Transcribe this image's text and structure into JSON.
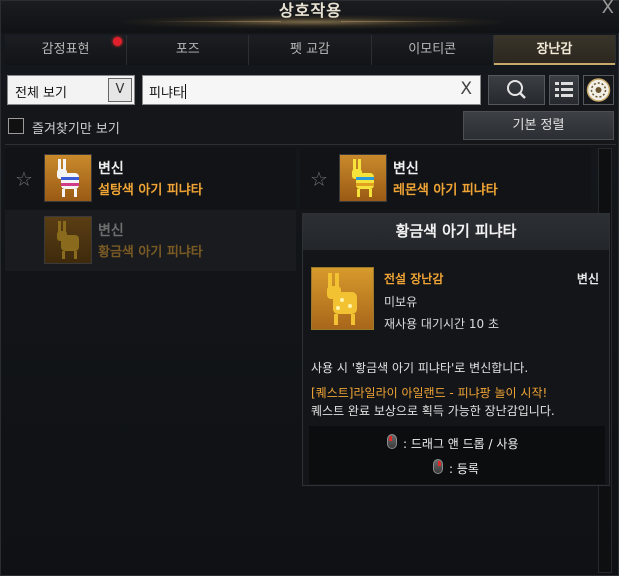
{
  "window": {
    "title": "상호작용",
    "close_symbol": "X"
  },
  "tabs": [
    {
      "label": "감정표현",
      "active": false,
      "has_notification": true
    },
    {
      "label": "포즈",
      "active": false
    },
    {
      "label": "펫 교감",
      "active": false
    },
    {
      "label": "이모티콘",
      "active": false
    },
    {
      "label": "장난감",
      "active": true
    }
  ],
  "filter": {
    "dropdown_value": "전체 보기",
    "dropdown_arrow": "V",
    "search_value": "피냐타",
    "clear_symbol": "X"
  },
  "favorites_only_label": "즐겨찾기만 보기",
  "sort_button_label": "기본 정렬",
  "items": [
    {
      "category": "변신",
      "name": "설탕색 아기 피냐타",
      "icon": "pinata-icon-sugar"
    },
    {
      "category": "변신",
      "name": "레몬색 아기 피냐타",
      "icon": "pinata-icon-lemon"
    },
    {
      "category": "변신",
      "name": "황금색 아기 피냐타",
      "icon": "pinata-icon-gold"
    }
  ],
  "tooltip": {
    "title": "황금색 아기 피냐타",
    "grade": "전설 장난감",
    "type": "변신",
    "owned_status": "미보유",
    "cooldown": "재사용 대기시간 10 초",
    "description": "사용 시 '황금색 아기 피냐타'로 변신합니다.",
    "quest": "[퀘스트]라일라이 아일랜드 - 피냐팡 놀이 시작!",
    "quest_description": "퀘스트 완료 보상으로 획득 가능한 장난감입니다.",
    "control_drag": ": 드래그 앤 드롭 / 사용",
    "control_register": ": 등록"
  },
  "colors": {
    "accent_gold": "#c7a96a",
    "item_name_orange": "#f0a435",
    "notification_red": "#e0202a"
  }
}
